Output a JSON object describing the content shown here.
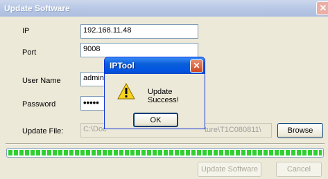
{
  "window": {
    "title": "Update Software",
    "close_glyph": "✕"
  },
  "form": {
    "ip_label": "IP",
    "ip_value": "192.168.11.48",
    "port_label": "Port",
    "port_value": "9008",
    "username_label": "User Name",
    "username_value": "admin",
    "password_label": "Password",
    "password_value": "•••••",
    "update_file_label": "Update File:",
    "update_file_value": "C:\\Doc",
    "update_file_value_tail": "ture\\T1C080811\\",
    "browse_label": "Browse"
  },
  "progress": {
    "value": 1.0,
    "color": "#2fd02f"
  },
  "footer": {
    "update_button": "Update Software",
    "cancel_button": "Cancel"
  },
  "dialog": {
    "title": "IPTool",
    "close_glyph": "✕",
    "icon": "warning-icon",
    "message": "Update Success!",
    "ok_label": "OK"
  }
}
